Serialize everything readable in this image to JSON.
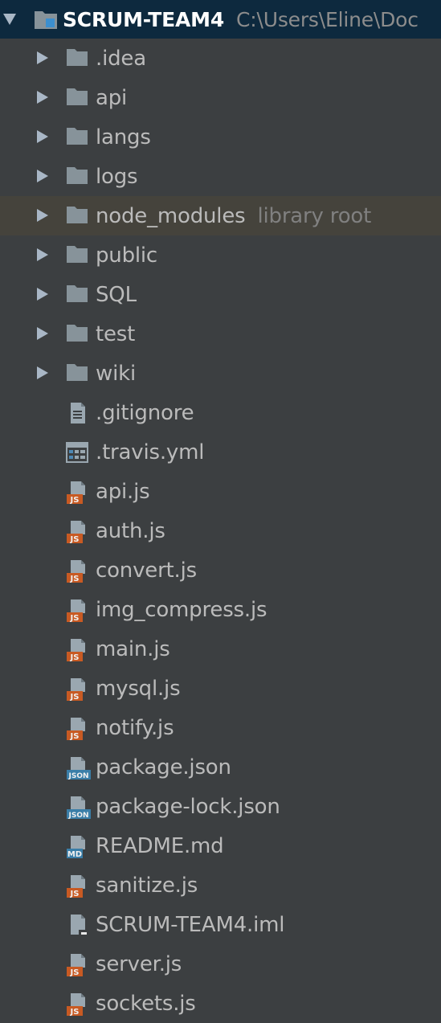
{
  "project": {
    "name": "SCRUM-TEAM4",
    "path": "C:\\Users\\Eline\\Doc",
    "icon": "project-folder-icon"
  },
  "folders": [
    {
      "name": ".idea",
      "icon": "folder-icon"
    },
    {
      "name": "api",
      "icon": "folder-icon"
    },
    {
      "name": "langs",
      "icon": "folder-icon"
    },
    {
      "name": "logs",
      "icon": "folder-icon"
    },
    {
      "name": "node_modules",
      "icon": "folder-icon",
      "hint": "library root"
    },
    {
      "name": "public",
      "icon": "folder-icon"
    },
    {
      "name": "SQL",
      "icon": "folder-icon"
    },
    {
      "name": "test",
      "icon": "folder-icon"
    },
    {
      "name": "wiki",
      "icon": "folder-icon"
    }
  ],
  "files": [
    {
      "name": ".gitignore",
      "icon": "text-file-icon"
    },
    {
      "name": ".travis.yml",
      "icon": "yml-file-icon"
    },
    {
      "name": "api.js",
      "icon": "js-file-icon",
      "badge": "JS"
    },
    {
      "name": "auth.js",
      "icon": "js-file-icon",
      "badge": "JS"
    },
    {
      "name": "convert.js",
      "icon": "js-file-icon",
      "badge": "JS"
    },
    {
      "name": "img_compress.js",
      "icon": "js-file-icon",
      "badge": "JS"
    },
    {
      "name": "main.js",
      "icon": "js-file-icon",
      "badge": "JS"
    },
    {
      "name": "mysql.js",
      "icon": "js-file-icon",
      "badge": "JS"
    },
    {
      "name": "notify.js",
      "icon": "js-file-icon",
      "badge": "JS"
    },
    {
      "name": "package.json",
      "icon": "json-file-icon",
      "badge": "JSON"
    },
    {
      "name": "package-lock.json",
      "icon": "json-file-icon",
      "badge": "JSON"
    },
    {
      "name": "README.md",
      "icon": "md-file-icon",
      "badge": "MD"
    },
    {
      "name": "sanitize.js",
      "icon": "js-file-icon",
      "badge": "JS"
    },
    {
      "name": "SCRUM-TEAM4.iml",
      "icon": "iml-file-icon"
    },
    {
      "name": "server.js",
      "icon": "js-file-icon",
      "badge": "JS"
    },
    {
      "name": "sockets.js",
      "icon": "js-file-icon",
      "badge": "JS"
    }
  ],
  "colors": {
    "background": "#3c3f41",
    "root_selection": "#0d293e",
    "row_highlight": "#45433c",
    "folder": "#87939a",
    "js_badge": "#c85a23",
    "json_badge": "#3a7ea8",
    "md_badge": "#3a7ea8"
  }
}
